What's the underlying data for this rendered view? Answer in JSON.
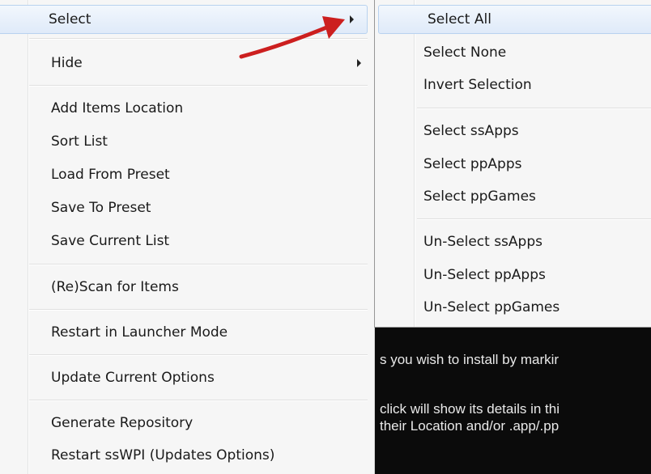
{
  "main_menu": {
    "items": [
      {
        "label": "Select",
        "has_submenu": true
      },
      {
        "label": "Hide",
        "has_submenu": true
      },
      {
        "label": "Add Items Location"
      },
      {
        "label": "Sort List"
      },
      {
        "label": "Load From Preset"
      },
      {
        "label": "Save To Preset"
      },
      {
        "label": "Save Current List"
      },
      {
        "label": "(Re)Scan for Items"
      },
      {
        "label": "Restart in Launcher Mode"
      },
      {
        "label": "Update Current Options"
      },
      {
        "label": "Generate Repository"
      },
      {
        "label": "Restart ssWPI (Updates Options)"
      }
    ]
  },
  "submenu": {
    "items": [
      {
        "label": "Select All"
      },
      {
        "label": "Select None"
      },
      {
        "label": "Invert Selection"
      },
      {
        "label": "Select ssApps"
      },
      {
        "label": "Select ppApps"
      },
      {
        "label": "Select ppGames"
      },
      {
        "label": "Un-Select ssApps"
      },
      {
        "label": "Un-Select ppApps"
      },
      {
        "label": "Un-Select ppGames"
      }
    ]
  },
  "background_window": {
    "lines": [
      "s you wish to install by markir",
      "click will show its details in thi",
      "their Location and/or .app/.pp",
      ""
    ]
  },
  "colors": {
    "menu_bg": "#f6f6f6",
    "hover_bg": "#dfeaf9",
    "hover_border": "#b8d2ef",
    "annotation_arrow": "#cc1f1f",
    "background_window": "#0b0b0b"
  }
}
